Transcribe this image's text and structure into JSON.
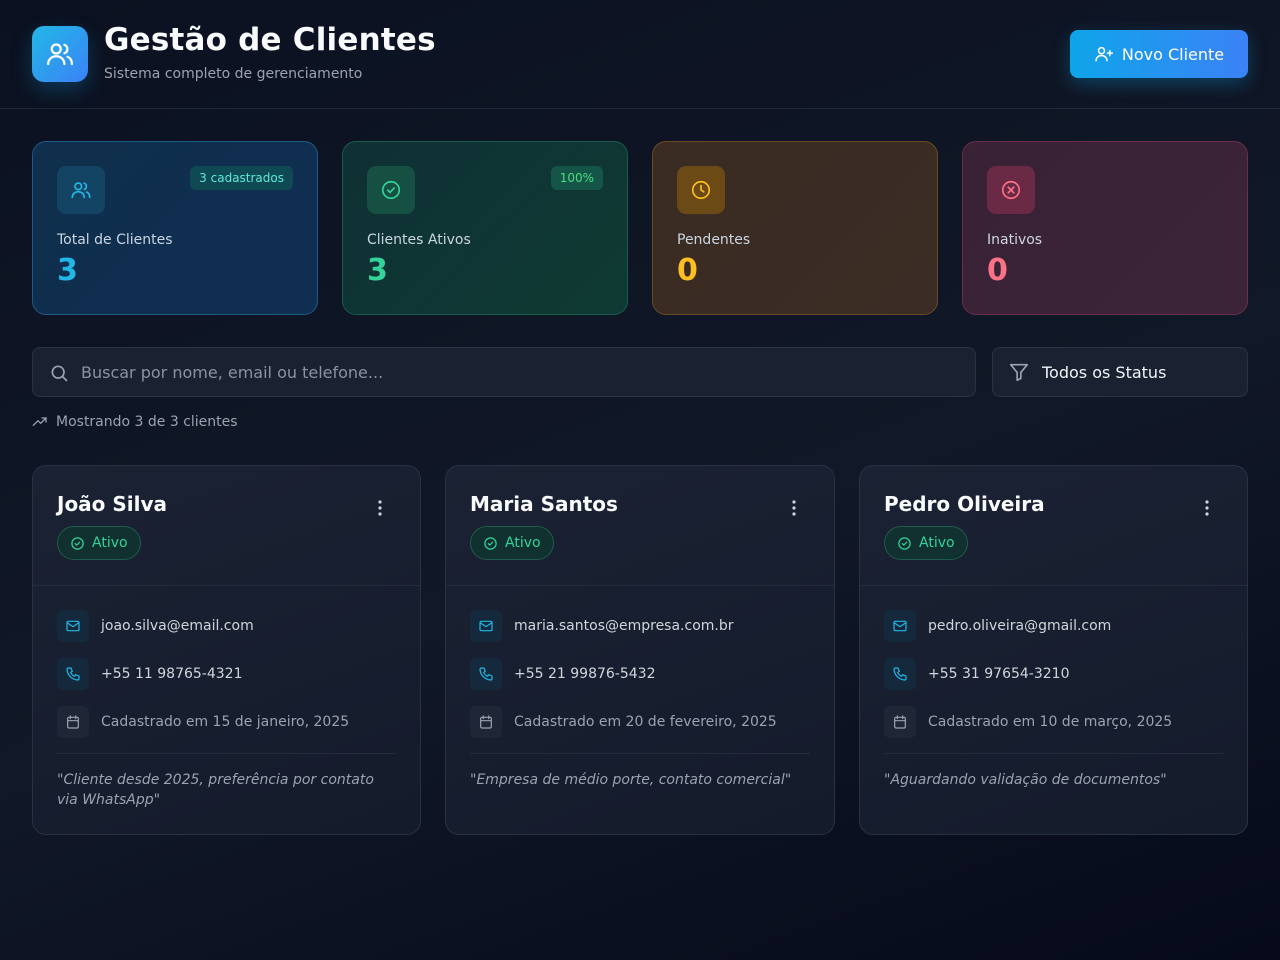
{
  "header": {
    "title": "Gestão de Clientes",
    "subtitle": "Sistema completo de gerenciamento",
    "new_button": "Novo Cliente"
  },
  "stats": [
    {
      "label": "Total de Clientes",
      "value": "3",
      "badge": "3 cadastrados",
      "icon": "users-icon",
      "color": "#22b8e6"
    },
    {
      "label": "Clientes Ativos",
      "value": "3",
      "badge": "100%",
      "icon": "check-circle-icon",
      "color": "#34d399"
    },
    {
      "label": "Pendentes",
      "value": "0",
      "badge": "",
      "icon": "clock-icon",
      "color": "#fbbf24"
    },
    {
      "label": "Inativos",
      "value": "0",
      "badge": "",
      "icon": "x-circle-icon",
      "color": "#fb7185"
    }
  ],
  "search": {
    "placeholder": "Buscar por nome, email ou telefone...",
    "value": ""
  },
  "filter": {
    "selected": "Todos os Status"
  },
  "results_text": "Mostrando 3 de 3 clientes",
  "clients": [
    {
      "name": "João Silva",
      "status": "Ativo",
      "email": "joao.silva@email.com",
      "phone": "+55 11 98765-4321",
      "registered": "Cadastrado em 15 de janeiro, 2025",
      "note": "\"Cliente desde 2025, preferência por contato via WhatsApp\""
    },
    {
      "name": "Maria Santos",
      "status": "Ativo",
      "email": "maria.santos@empresa.com.br",
      "phone": "+55 21 99876-5432",
      "registered": "Cadastrado em 20 de fevereiro, 2025",
      "note": "\"Empresa de médio porte, contato comercial\""
    },
    {
      "name": "Pedro Oliveira",
      "status": "Ativo",
      "email": "pedro.oliveira@gmail.com",
      "phone": "+55 31 97654-3210",
      "registered": "Cadastrado em 10 de março, 2025",
      "note": "\"Aguardando validação de documentos\""
    }
  ],
  "colors": {
    "accent": "#0ea5e9",
    "accent2": "#3b82f6",
    "active": "#34d399",
    "pending": "#fbbf24",
    "inactive": "#fb7185"
  }
}
